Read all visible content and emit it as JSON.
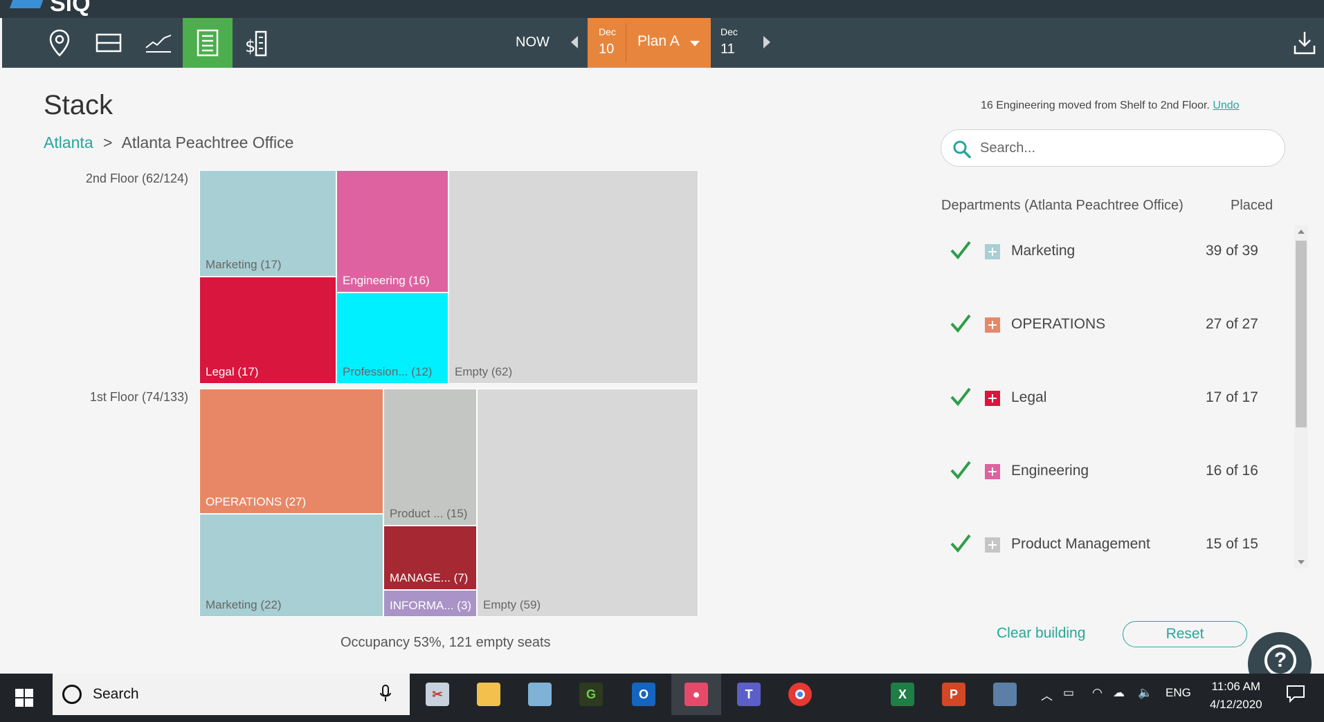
{
  "app": {
    "logo_text": "SiQ"
  },
  "toolbar": {
    "now_label": "NOW",
    "current_date": {
      "month": "Dec",
      "day": "10"
    },
    "plan_label": "Plan A",
    "next_date": {
      "month": "Dec",
      "day": "11"
    },
    "icons": [
      "location-icon",
      "floors-icon",
      "chart-icon",
      "stack-icon",
      "cost-icon",
      "download-icon"
    ]
  },
  "page": {
    "title": "Stack",
    "breadcrumb": {
      "parent": "Atlanta",
      "separator": ">",
      "current": "Atlanta Peachtree Office"
    }
  },
  "stack": {
    "floors": [
      {
        "label": "2nd Floor (62/124)",
        "tiles": [
          {
            "label": "Marketing (17)",
            "color": "#a8cfd3"
          },
          {
            "label": "Engineering (16)",
            "color": "#de62a0"
          },
          {
            "label": "Legal (17)",
            "color": "#d8163e"
          },
          {
            "label": "Profession...  (12)",
            "color": "#00f0ff"
          },
          {
            "label": "Empty (62)",
            "color": "#d8d8d8"
          }
        ]
      },
      {
        "label": "1st Floor (74/133)",
        "tiles": [
          {
            "label": "OPERATIONS (27)",
            "color": "#e88766"
          },
          {
            "label": "Product ... (15)",
            "color": "#c4c6c4"
          },
          {
            "label": "Marketing (22)",
            "color": "#a8cfd3"
          },
          {
            "label": "MANAGE...  (7)",
            "color": "#a52833"
          },
          {
            "label": "INFORMA... (3)",
            "color": "#a993c7"
          },
          {
            "label": "Empty (59)",
            "color": "#d8d8d8"
          }
        ]
      }
    ],
    "occupancy": "Occupancy 53%, 121 empty seats"
  },
  "panel": {
    "notice": {
      "text": "16 Engineering moved from Shelf to 2nd Floor.",
      "undo": "Undo"
    },
    "search_placeholder": "Search...",
    "header_departments": "Departments (Atlanta Peachtree Office)",
    "header_placed": "Placed",
    "departments": [
      {
        "name": "Marketing",
        "placed": "39 of 39",
        "color": "#a8cfd3"
      },
      {
        "name": "OPERATIONS",
        "placed": "27 of 27",
        "color": "#e88766"
      },
      {
        "name": "Legal",
        "placed": "17 of 17",
        "color": "#d8163e"
      },
      {
        "name": "Engineering",
        "placed": "16 of 16",
        "color": "#de62a0"
      },
      {
        "name": "Product Management",
        "placed": "15 of 15",
        "color": "#c4c6c4"
      }
    ],
    "clear_label": "Clear building",
    "reset_label": "Reset",
    "help_label": "?"
  },
  "taskbar": {
    "search_label": "Search",
    "apps": [
      "snipping-icon",
      "file-explorer-icon",
      "notepad-icon",
      "greenshot-icon",
      "outlook-icon",
      "camera-icon",
      "teams-icon",
      "chrome-icon",
      "excel-icon",
      "powerpoint-icon",
      "remote-icon"
    ],
    "lang": "ENG",
    "time": "11:06 AM",
    "date": "4/12/2020"
  },
  "colors": {
    "accent": "#26a69a",
    "toolbar": "#37474f",
    "plan": "#e8853d",
    "active_tab": "#4cae4c"
  }
}
